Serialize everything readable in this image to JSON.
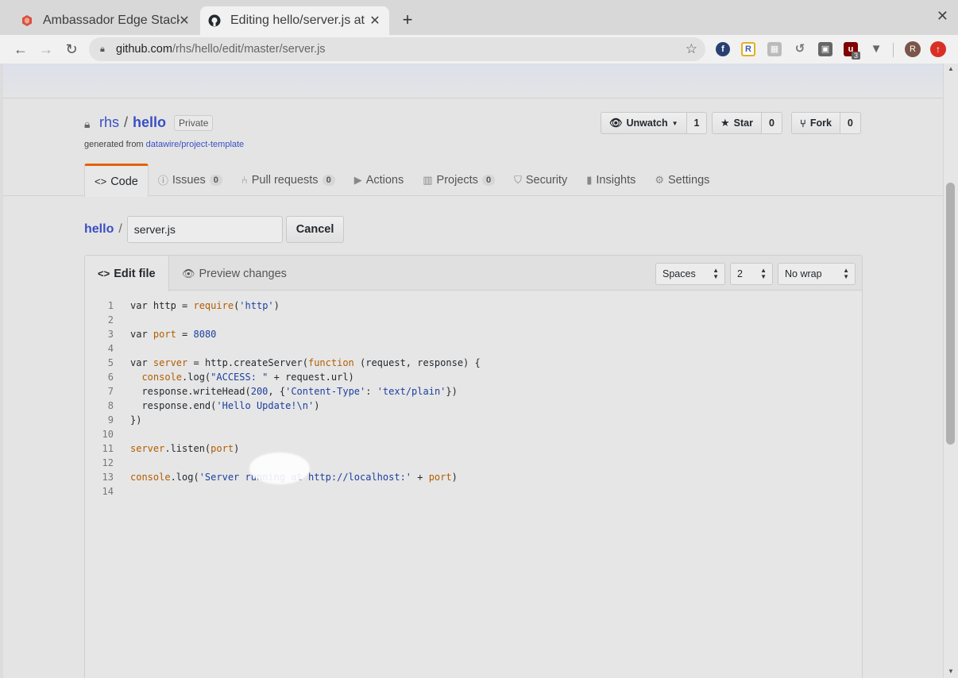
{
  "browser": {
    "tabs": [
      {
        "title": "Ambassador Edge Stack E",
        "icon": "ambassador-icon"
      },
      {
        "title": "Editing hello/server.js at m",
        "icon": "github-icon"
      }
    ],
    "url_host": "github.com",
    "url_path": "/rhs/hello/edit/master/server.js",
    "extension_badge": "3",
    "avatar_letter": "R"
  },
  "repo": {
    "owner": "rhs",
    "name": "hello",
    "visibility": "Private",
    "generated_prefix": "generated from",
    "generated_link": "datawire/project-template",
    "watch_label": "Unwatch",
    "watch_count": "1",
    "star_label": "Star",
    "star_count": "0",
    "fork_label": "Fork",
    "fork_count": "0"
  },
  "nav": {
    "code": "Code",
    "issues": "Issues",
    "issues_count": "0",
    "pulls": "Pull requests",
    "pulls_count": "0",
    "actions": "Actions",
    "projects": "Projects",
    "projects_count": "0",
    "security": "Security",
    "insights": "Insights",
    "settings": "Settings"
  },
  "editor": {
    "breadcrumb_root": "hello",
    "breadcrumb_sep": "/",
    "filename": "server.js",
    "cancel_label": "Cancel",
    "tab_edit": "Edit file",
    "tab_preview": "Preview changes",
    "indent_mode": "Spaces",
    "indent_size": "2",
    "wrap_mode": "No wrap"
  },
  "code_lines": [
    "var http = require('http')",
    "",
    "var port = 8080",
    "",
    "var server = http.createServer(function (request, response) {",
    "  console.log(\"ACCESS: \" + request.url)",
    "  response.writeHead(200, {'Content-Type': 'text/plain'})",
    "  response.end('Hello Update!\\n')",
    "})",
    "",
    "server.listen(port)",
    "",
    "console.log('Server running at http://localhost:' + port)",
    ""
  ],
  "colors": {
    "link": "#3a4fc4",
    "keyword": "#b35c00",
    "string": "#1d3fa0",
    "tab_accent": "#e36209"
  }
}
